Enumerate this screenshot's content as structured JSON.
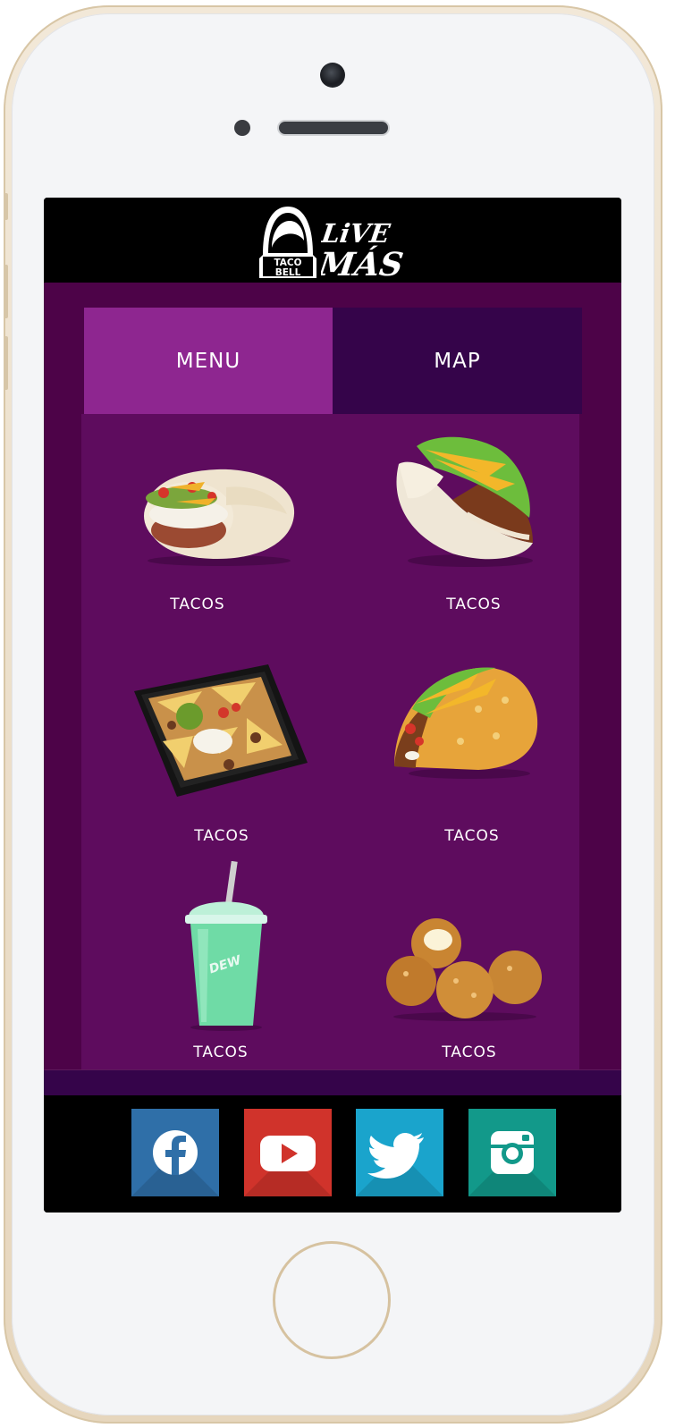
{
  "brand": {
    "logo_text_line1": "TACO",
    "logo_text_line2": "BELL",
    "slogan_line1": "LiVE",
    "slogan_line2": "MÁS"
  },
  "tabs": [
    {
      "label": "MENU",
      "active": true
    },
    {
      "label": "MAP",
      "active": false
    }
  ],
  "menu_items": [
    {
      "label": "TACOS",
      "image": "burrito"
    },
    {
      "label": "TACOS",
      "image": "chalupa"
    },
    {
      "label": "TACOS",
      "image": "nachos"
    },
    {
      "label": "TACOS",
      "image": "crunchy-taco"
    },
    {
      "label": "TACOS",
      "image": "mountain-dew-baja-blast-freeze"
    },
    {
      "label": "TACOS",
      "image": "cinnamon-delights"
    }
  ],
  "social": [
    {
      "name": "facebook",
      "color": "#2f6fa8"
    },
    {
      "name": "youtube",
      "color": "#d0332b"
    },
    {
      "name": "twitter",
      "color": "#1aa4cc"
    },
    {
      "name": "instagram",
      "color": "#12998a"
    }
  ],
  "colors": {
    "active_tab": "#8e2690",
    "inactive_tab": "#35044a",
    "background": "#4d0348",
    "grid": "#5e0c5e"
  }
}
